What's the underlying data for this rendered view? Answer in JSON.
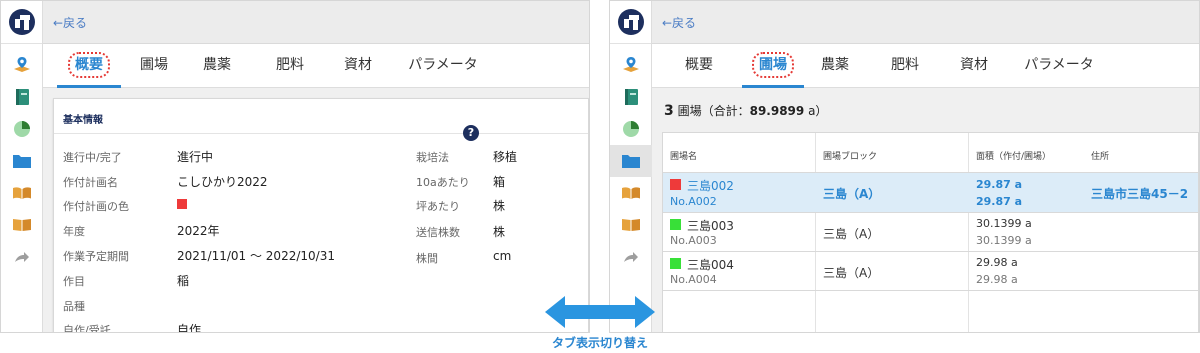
{
  "colors": {
    "accent": "#2a86d0",
    "brand": "#1d2f5e",
    "highlight_outline": "#e53935",
    "plot_red": "#ee3a3a",
    "plot_green": "#38e038"
  },
  "sidebar": {
    "icons": [
      "logo",
      "map-pin-icon",
      "notebook-icon",
      "pie-chart-icon",
      "folder-icon",
      "open-book-icon",
      "book-icon",
      "share-arrow-icon"
    ]
  },
  "left": {
    "back": "←戻る",
    "tabs": [
      "概要",
      "圃場",
      "農薬",
      "肥料",
      "資材",
      "パラメータ"
    ],
    "active_tab": "概要",
    "section_title": "基本情報",
    "fields_left": [
      {
        "label": "進行中/完了",
        "value": "進行中"
      },
      {
        "label": "作付計画名",
        "value": "こしひかり2022"
      },
      {
        "label": "作付計画の色",
        "value": ""
      },
      {
        "label": "年度",
        "value": "2022年"
      },
      {
        "label": "作業予定期間",
        "value": "2021/11/01 〜 2022/10/31"
      },
      {
        "label": "作目",
        "value": "稲"
      },
      {
        "label": "品種",
        "value": ""
      },
      {
        "label": "自作/受託",
        "value": "自作"
      }
    ],
    "fields_right": [
      {
        "label": "栽培法",
        "value": "移植"
      },
      {
        "label": "10aあたり",
        "value": "箱"
      },
      {
        "label": "坪あたり",
        "value": "株"
      },
      {
        "label": "送信株数",
        "value": "株"
      },
      {
        "label": "株間",
        "value": "cm"
      }
    ],
    "help_glyph": "?"
  },
  "right": {
    "back": "←戻る",
    "tabs": [
      "概要",
      "圃場",
      "農薬",
      "肥料",
      "資材",
      "パラメータ"
    ],
    "active_tab": "圃場",
    "summary": {
      "count": "3",
      "unit": "圃場（合計：",
      "total": "89.9899",
      "suffix": " a）"
    },
    "table": {
      "headers": [
        "圃場名",
        "圃場ブロック",
        "面積（作付/圃場）",
        "住所"
      ],
      "rows": [
        {
          "name": "三島002",
          "no": "No.A002",
          "block": "三島（A）",
          "area1": "29.87 a",
          "area2": "29.87 a",
          "address": "三島市三島45－2",
          "color": "#ee3a3a",
          "selected": true
        },
        {
          "name": "三島003",
          "no": "No.A003",
          "block": "三島（A）",
          "area1": "30.1399 a",
          "area2": "30.1399 a",
          "address": "",
          "color": "#38e038",
          "selected": false
        },
        {
          "name": "三島004",
          "no": "No.A004",
          "block": "三島（A）",
          "area1": "29.98 a",
          "area2": "29.98 a",
          "address": "",
          "color": "#38e038",
          "selected": false
        }
      ]
    }
  },
  "caption": "タブ表示切り替え"
}
